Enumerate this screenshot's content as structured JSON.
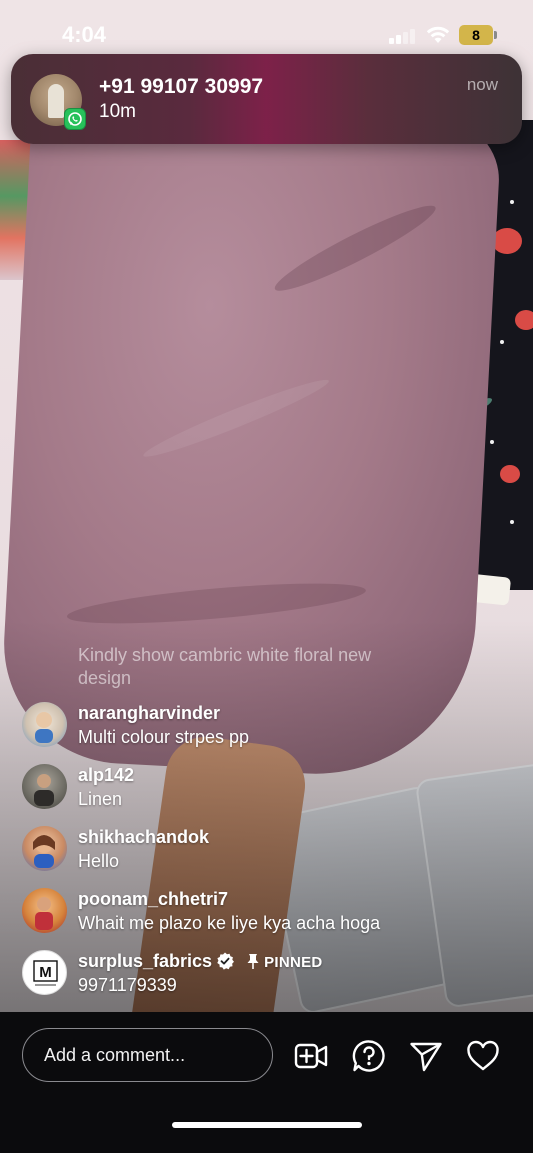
{
  "status_bar": {
    "time": "4:04",
    "battery_level": "8"
  },
  "notification": {
    "title": "+91 99107 30997",
    "body": "10m",
    "time": "now",
    "app_icon": "whatsapp-icon"
  },
  "comments": {
    "faded": "Kindly show cambric white floral new design",
    "items": [
      {
        "user": "narangharvinder",
        "text": "Multi colour  strpes pp"
      },
      {
        "user": "alp142",
        "text": "Linen"
      },
      {
        "user": "shikhachandok",
        "text": "Hello"
      },
      {
        "user": "poonam_chhetri7",
        "text": "Whait me plazo ke liye kya acha hoga"
      }
    ],
    "pinned": {
      "user": "surplus_fabrics",
      "pinned_label": "PINNED",
      "text": "9971179339",
      "avatar_letter": "M"
    }
  },
  "bottom_bar": {
    "comment_placeholder": "Add a comment...",
    "icons": [
      "add-video-icon",
      "question-icon",
      "send-icon",
      "heart-icon"
    ]
  },
  "colors": {
    "whatsapp": "#27c15a",
    "battery": "#d3b54a",
    "background": "#0b0b0d"
  }
}
